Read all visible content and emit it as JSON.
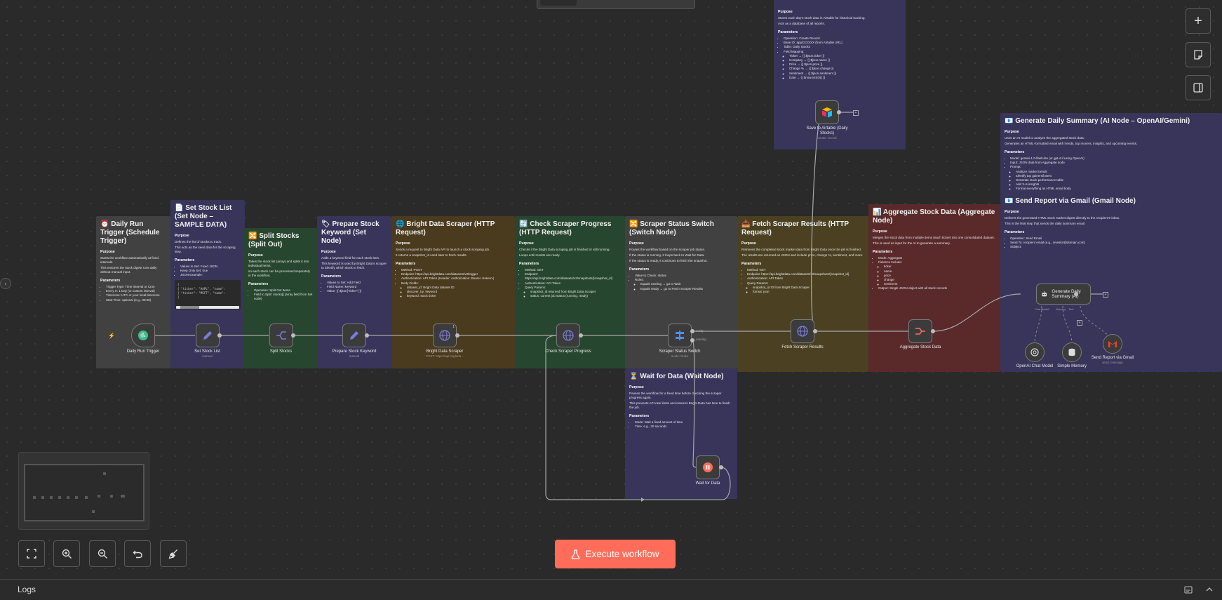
{
  "toolbar": {
    "add": "+",
    "execute_label": "Execute workflow"
  },
  "logs": {
    "label": "Logs"
  },
  "notes": {
    "trigger": {
      "title": "⏰ Daily Run Trigger (Schedule Trigger)",
      "purpose": "Purpose",
      "p": [
        "Starts the workflow automatically at fixed intervals.",
        "This ensures the stock digest runs daily without manual input."
      ],
      "params": "Parameters",
      "items": [
        "Trigger Type: Time Interval or Cron",
        "Every X: 1 Day (or custom interval)",
        "Timezone: UTC or your local timezone",
        "Start Time: optional (e.g., 09:00)"
      ]
    },
    "setlist": {
      "title": "📄 Set Stock List (Set Node – SAMPLE DATA)",
      "purpose": "Purpose",
      "p": [
        "Defines the list of stocks to track.",
        "This acts as the seed data for the scraping step."
      ],
      "params": "Parameters",
      "items": [
        "Values to Set: Fixed JSON",
        "Keep Only Set: true",
        "JSON Example:"
      ],
      "code": [
        "[",
        "  { \"ticker\": \"AAPL\", \"name\":",
        "  { \"ticker\": \"MSFT\", \"name\":",
        "]"
      ]
    },
    "split": {
      "title": "🔀 Split Stocks (Split Out)",
      "purpose": "Purpose",
      "p": [
        "Takes the stock list (array) and splits it into individual items,",
        "so each stock can be processed separately in the workflow."
      ],
      "params": "Parameters",
      "items": [
        "Operation: Split Out Items",
        "Field to Split: stocks[] (array field from Set node)"
      ]
    },
    "prepare": {
      "title": "🏷 Prepare Stock Keyword (Set Node)",
      "purpose": "Purpose",
      "p": [
        "Adds a keyword field for each stock item.",
        "This keyword is used by Bright Data's scraper to identify which stock to fetch."
      ],
      "params": "Parameters",
      "items": [
        "Values to Set: Add Field",
        "Field Name: keyword",
        "Value: {{ $json[\"ticker\"] }}"
      ]
    },
    "bright": {
      "title": "🌐 Bright Data Scraper (HTTP Request)",
      "purpose": "Purpose",
      "p": [
        "Sends a request to Bright Data API to launch a stock scraping job.",
        "It returns a snapshot_id used later to fetch results."
      ],
      "params": "Parameters",
      "items": [
        "Method: POST",
        "Endpoint: https://api.brightdata.com/datasets/v3/trigger",
        "Authentication: API Token (Header: Authorization: Bearer <token>)",
        "Body Fields:",
        "dataset_id: Bright Data dataset ID",
        "discover_by: keyword",
        "keyword: stock ticker"
      ]
    },
    "check": {
      "title": "🔄 Check Scraper Progress (HTTP Request)",
      "purpose": "Purpose",
      "p": [
        "Checks if the Bright Data scraping job is finished or still running.",
        "Loops until results are ready."
      ],
      "params": "Parameters",
      "items": [
        "Method: GET",
        "Endpoint: https://api.brightdata.com/datasets/v3/snapshots/{snapshot_id}",
        "Authentication: API Token",
        "Query Params:",
        "snapshot_id returned from Bright Data Scraper",
        "status: current job status (running, ready)"
      ]
    },
    "switch": {
      "title": "🔀 Scraper Status Switch (Switch Node)",
      "purpose": "Purpose",
      "p": [
        "Routes the workflow based on the scraper job status.",
        "If the status is running, it loops back to Wait for Data.",
        "If the status is ready, it continues to fetch the snapshot."
      ],
      "params": "Parameters",
      "items": [
        "Value to Check: status",
        "Rules:",
        "Equals running → go to Wait",
        "Equals ready → go to Fetch Scraper Results"
      ]
    },
    "fetch": {
      "title": "📥 Fetch Scraper Results (HTTP Request)",
      "purpose": "Purpose",
      "p": [
        "Retrieves the completed stock market data from Bright Data once the job is finished.",
        "The results are returned as JSON and include price, change %, sentiment, and more."
      ],
      "params": "Parameters",
      "items": [
        "Method: GET",
        "Endpoint: https://api.brightdata.com/datasets/v3/snapshots/{snapshot_id}",
        "Authentication: API Token",
        "Query Params:",
        "snapshot_id ID from Bright Data Scraper",
        "format: json"
      ]
    },
    "aggregate": {
      "title": "📊 Aggregate Stock Data (Aggregate Node)",
      "purpose": "Purpose",
      "p": [
        "Merges the stock data from multiple items (each ticker) into one consolidated dataset.",
        "This is used as input for the AI to generate a summary."
      ],
      "params": "Parameters",
      "items": [
        "Mode: Aggregate",
        "Fields to Include:",
        "ticker",
        "name",
        "price",
        "change",
        "sentiment",
        "Output: Single JSON object with all stock records"
      ]
    },
    "airtable": {
      "title": "",
      "purpose": "Purpose",
      "p": [
        "Stores each day's stock data in Airtable for historical tracking.",
        "Acts as a database of all reports."
      ],
      "params": "Parameters",
      "items": [
        "Operation: Create Record",
        "Base ID: appXXXXXX (from Airtable URL)",
        "Table: Daily Stocks",
        "Field Mapping:",
        "Ticker → {{ $json.ticker }}",
        "Company → {{ $json.name }}",
        "Price → {{ $json.price }}",
        "Change % → {{ $json.change }}",
        "Sentiment → {{ $json.sentiment }}",
        "Date → {{ $now.toISO() }}"
      ]
    },
    "summary": {
      "title": "📧 Generate Daily Summary (AI Node – OpenAI/Gemini)",
      "purpose": "Purpose",
      "p": [
        "Uses an AI model to analyze the aggregated stock data.",
        "Generates an HTML-formatted email with trends, top movers, insights, and upcoming events."
      ],
      "params": "Parameters",
      "items": [
        "Model: gemini-1.0-flash-lite (or gpt-4 if using OpenAI)",
        "Input: JSON data from Aggregate node",
        "Prompt:",
        "Analyze market trends",
        "Identify top gainers/losers",
        "Generate stock performance table",
        "Add 3–5 insights",
        "Format everything as HTML email body"
      ]
    },
    "gmail": {
      "title": "📧 Send Report via Gmail (Gmail Node)",
      "purpose": "Purpose",
      "p": [
        "Delivers the generated HTML stock market digest directly to the recipient's inbox.",
        "This is the final step that sends the daily summary email."
      ],
      "params": "Parameters",
      "items": [
        "Operation: Send Email",
        "Send To: recipient email (e.g., investor@domain.com)",
        "Subject:"
      ]
    },
    "wait": {
      "title": "⏳ Wait for Data (Wait Node)",
      "purpose": "Purpose",
      "p": [
        "Pauses the workflow for a fixed time before checking the scraper progress again.",
        "This prevents API rate limits and ensures Bright Data has time to finish the job."
      ],
      "params": "Parameters",
      "items": [
        "Mode: Wait a fixed amount of time",
        "Time: e.g., 30 seconds"
      ]
    }
  },
  "nodes": {
    "trigger": {
      "label": "Daily Run Trigger",
      "sub": ""
    },
    "setlist": {
      "label": "Set Stock List",
      "sub": "manual"
    },
    "split": {
      "label": "Split Stocks",
      "sub": ""
    },
    "prepare": {
      "label": "Prepare Stock Keyword",
      "sub": "manual"
    },
    "bright": {
      "label": "Bright Data Scraper",
      "sub": "POST: https://api.brightda...",
      "badge": "1"
    },
    "check": {
      "label": "Check Scraper Progress",
      "sub": ""
    },
    "switch": {
      "label": "Scraper Status Switch",
      "sub": "mode: Rules",
      "out1": "ready",
      "out2": "running"
    },
    "fetch": {
      "label": "Fetch Scraper Results",
      "sub": ""
    },
    "aggregate": {
      "label": "Aggregate Stock Data",
      "sub": ""
    },
    "airtable": {
      "label": "Save to Airtable (Daily Stocks)",
      "sub": "create: record"
    },
    "summary": {
      "label": "Generate Daily Summary (AI)",
      "sub": ""
    },
    "openai": {
      "label": "OpenAI Chat Model",
      "sub": "",
      "port": "Model"
    },
    "memory": {
      "label": "Simple Memory",
      "sub": "",
      "port": "Memory"
    },
    "gmail": {
      "label": "Send Report via Gmail",
      "sub": "send: message"
    },
    "wait": {
      "label": "Wait for Data",
      "sub": ""
    },
    "summary_ports": {
      "chat": "Chat Model*",
      "memory": "Memory",
      "tool": "Tool"
    }
  },
  "colors": {
    "accent": "#ff6d5a",
    "edge": "#a8a8a8"
  }
}
